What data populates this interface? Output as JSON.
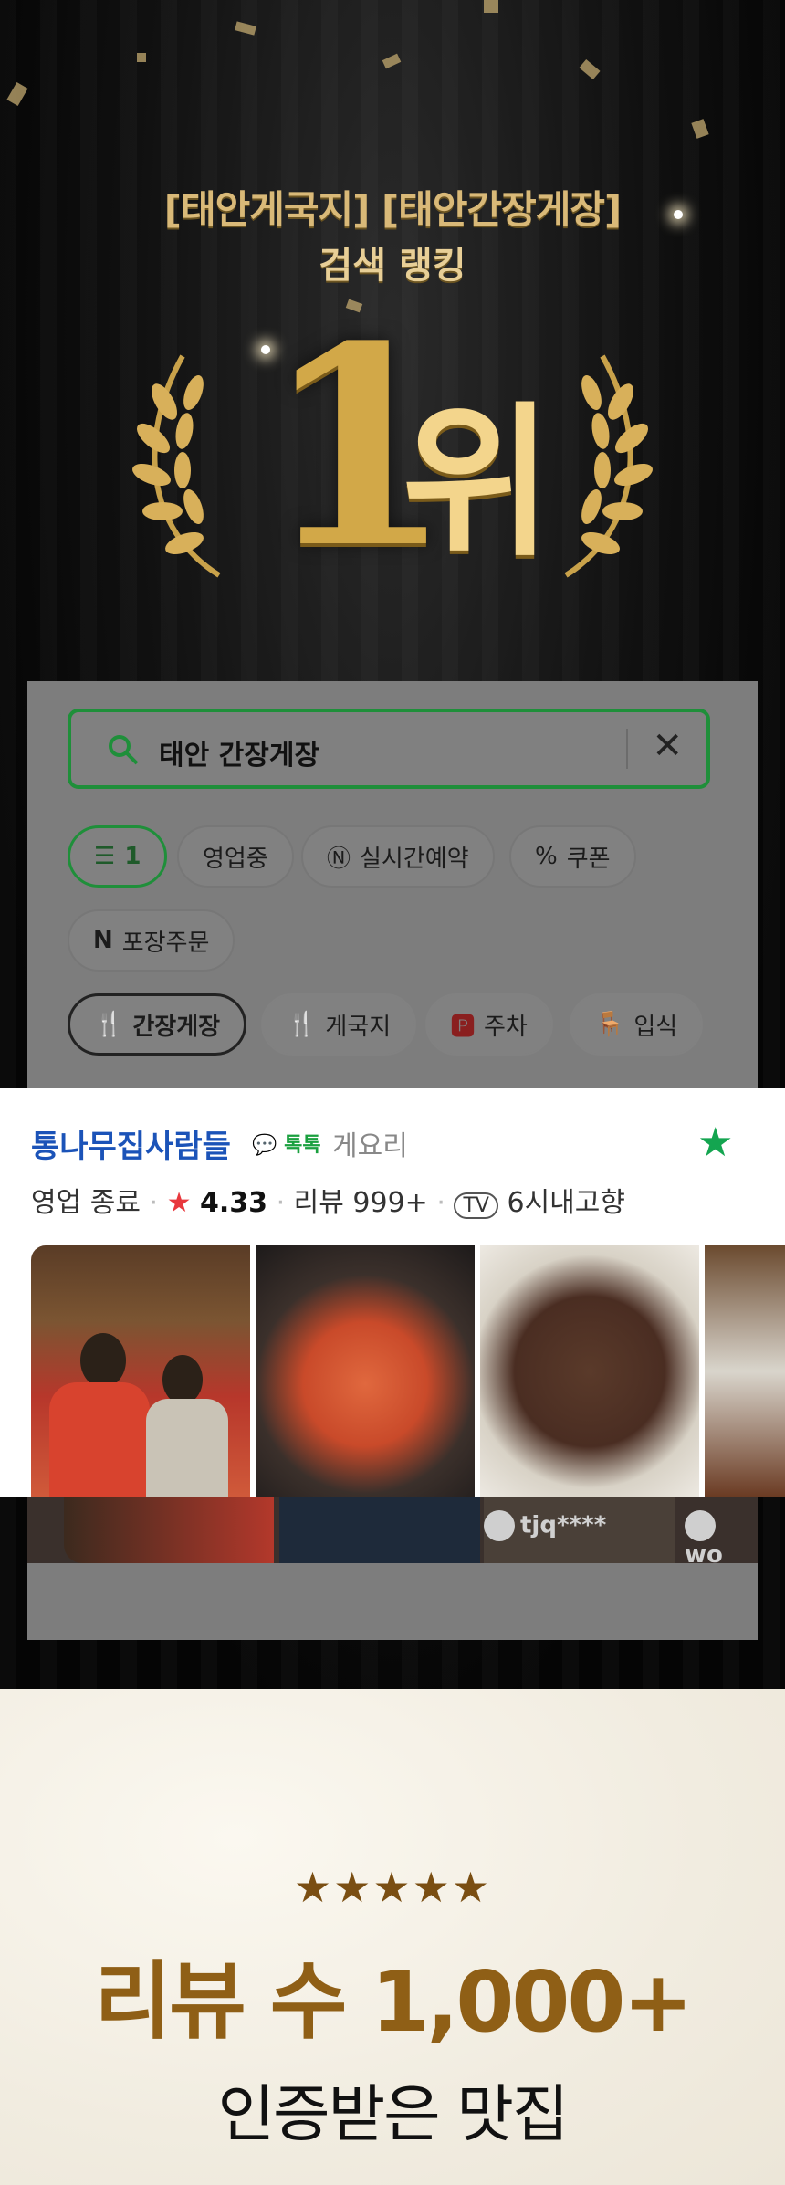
{
  "hero": {
    "title_line1": "[태안게국지] [태안간장게장]",
    "title_line2": "검색 랭킹",
    "rank_number": "1",
    "rank_unit": "위"
  },
  "search": {
    "query": "태안 간장게장",
    "clear_icon": "close-icon",
    "search_icon": "search-icon"
  },
  "filters": {
    "row1": [
      "1",
      "영업중",
      "실시간예약",
      "쿠폰"
    ],
    "row2": [
      "포장주문"
    ],
    "row3": [
      "간장게장",
      "게국지",
      "주차",
      "입식"
    ]
  },
  "listing": {
    "name": "통나무집사람들",
    "talk_label": "톡톡",
    "category": "게요리",
    "status": "영업 종료",
    "rating": "4.33",
    "reviews": "리뷰 999+",
    "tv_label": "TV",
    "tv_text": "6시내고향",
    "accent_color": "#14a550",
    "link_color": "#1b53b8"
  },
  "review_users": [
    "tjq****",
    "wo"
  ],
  "promo": {
    "stars": "★★★★★",
    "headline": "리뷰 수 1,000+",
    "subline": "인증받은 맛집"
  }
}
